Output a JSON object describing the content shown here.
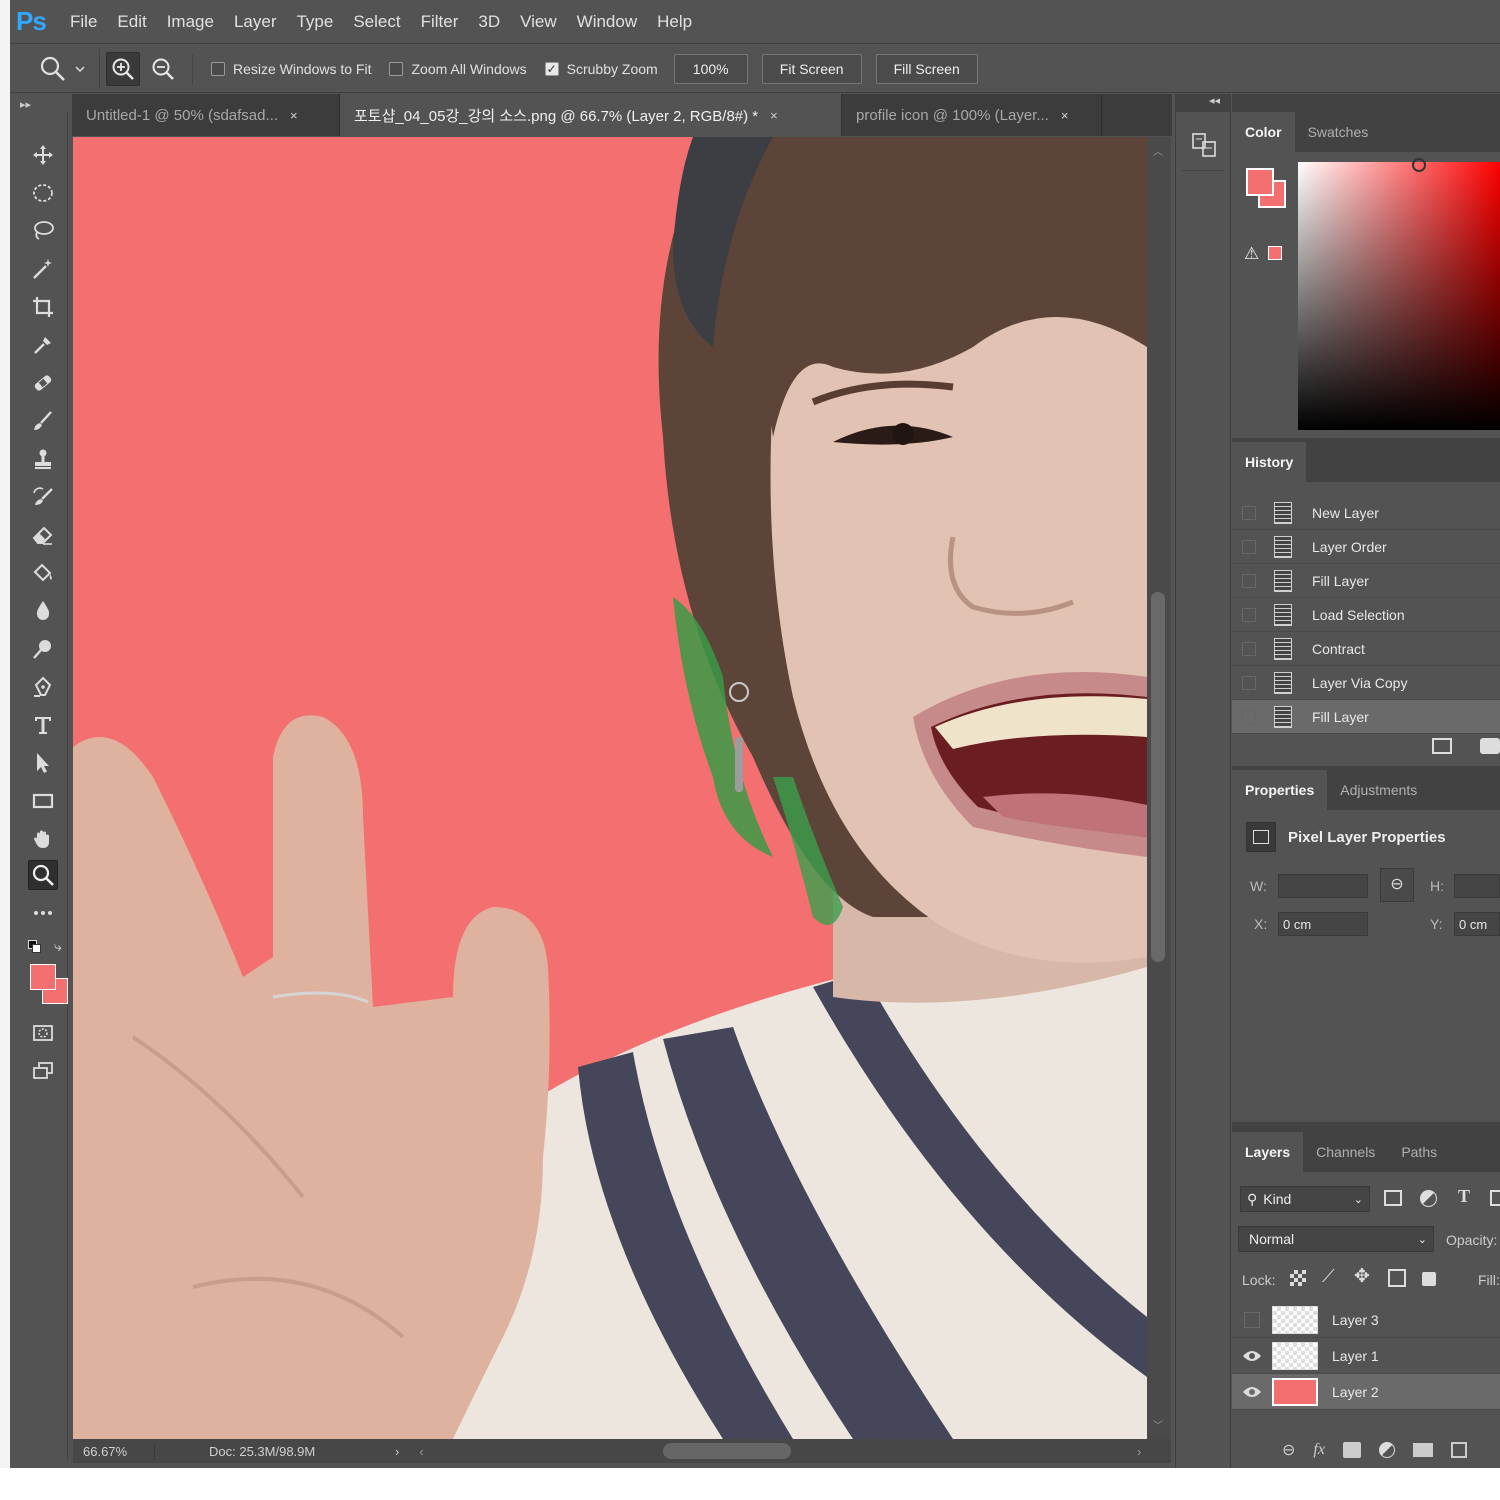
{
  "app": {
    "logo": "Ps"
  },
  "menu": [
    "File",
    "Edit",
    "Image",
    "Layer",
    "Type",
    "Select",
    "Filter",
    "3D",
    "View",
    "Window",
    "Help"
  ],
  "options": {
    "resize_windows": "Resize Windows to Fit",
    "zoom_all": "Zoom All Windows",
    "scrubby_zoom": "Scrubby Zoom",
    "zoom_value": "100%",
    "fit_screen": "Fit Screen",
    "fill_screen": "Fill Screen",
    "checked": {
      "resize_windows": false,
      "zoom_all": false,
      "scrubby_zoom": true
    }
  },
  "doc_tabs": [
    {
      "label": "Untitled-1 @ 50% (sdafsad...",
      "close": "×"
    },
    {
      "label": "포토샵_04_05강_강의 소스.png @ 66.7% (Layer 2, RGB/8#) *",
      "close": "×"
    },
    {
      "label": "profile icon @ 100% (Layer...",
      "close": "×"
    }
  ],
  "tools": [
    "move-tool-icon",
    "marquee-tool-icon",
    "lasso-tool-icon",
    "magic-wand-tool-icon",
    "crop-tool-icon",
    "eyedropper-tool-icon",
    "healing-brush-tool-icon",
    "brush-tool-icon",
    "clone-stamp-tool-icon",
    "history-brush-tool-icon",
    "eraser-tool-icon",
    "paint-bucket-tool-icon",
    "blur-tool-icon",
    "dodge-tool-icon",
    "pen-tool-icon",
    "type-tool-icon",
    "path-selection-tool-icon",
    "rectangle-tool-icon",
    "hand-tool-icon",
    "zoom-tool-icon",
    "more-tools-icon"
  ],
  "colors": {
    "foreground": "#f46f6f",
    "background": "#f46f6f",
    "canvas_bg": "#f46f6f",
    "accent": "#31a8ff"
  },
  "status": {
    "zoom": "66.67%",
    "doc": "Doc: 25.3M/98.9M"
  },
  "color_panel": {
    "tabs": [
      "Color",
      "Swatches"
    ]
  },
  "history": {
    "title": "History",
    "items": [
      "New Layer",
      "Layer Order",
      "Fill Layer",
      "Load Selection",
      "Contract",
      "Layer Via Copy",
      "Fill Layer"
    ]
  },
  "properties": {
    "tabs": [
      "Properties",
      "Adjustments"
    ],
    "heading": "Pixel Layer Properties",
    "w_label": "W:",
    "h_label": "H:",
    "x_label": "X:",
    "y_label": "Y:",
    "x_value": "0 cm",
    "y_value": "0 cm"
  },
  "layers": {
    "tabs": [
      "Layers",
      "Channels",
      "Paths"
    ],
    "kind": "Kind",
    "blend": "Normal",
    "opacity_label": "Opacity:",
    "lock_label": "Lock:",
    "fill_label": "Fill:",
    "items": [
      {
        "name": "Layer 3",
        "visible": false
      },
      {
        "name": "Layer 1",
        "visible": true
      },
      {
        "name": "Layer 2",
        "visible": true
      }
    ]
  }
}
